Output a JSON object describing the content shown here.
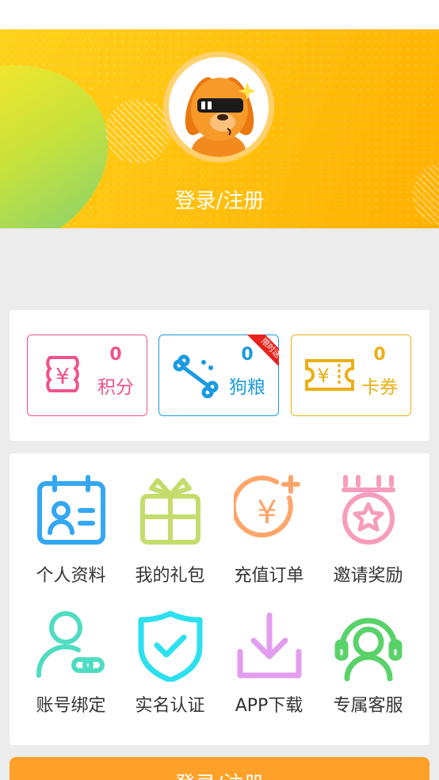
{
  "header": {
    "login_label": "登录/注册"
  },
  "wallet": {
    "points": {
      "value": "0",
      "label": "积分",
      "color": "#f0528c",
      "icon": "coin-stack-icon"
    },
    "dogfood": {
      "value": "0",
      "label": "狗粮",
      "color": "#1a9ae0",
      "icon": "bone-icon",
      "badge": "限时送",
      "badge_color": "#e8221a"
    },
    "coupons": {
      "value": "0",
      "label": "卡券",
      "color": "#ecae14",
      "icon": "ticket-icon"
    }
  },
  "menu": {
    "profile": {
      "label": "个人资料",
      "icon": "profile-card-icon",
      "color": "#35a7f2"
    },
    "gifts": {
      "label": "我的礼包",
      "icon": "gift-icon",
      "color": "#c4dc6c"
    },
    "recharge": {
      "label": "充值订单",
      "icon": "yen-add-icon",
      "color": "#ffa56a"
    },
    "invite": {
      "label": "邀请奖励",
      "icon": "medal-icon",
      "color": "#f79cbc"
    },
    "binding": {
      "label": "账号绑定",
      "icon": "user-link-icon",
      "color": "#4edcc2"
    },
    "verify": {
      "label": "实名认证",
      "icon": "shield-check-icon",
      "color": "#2ce0f0"
    },
    "download": {
      "label": "APP下载",
      "icon": "download-icon",
      "color": "#e39df0"
    },
    "service": {
      "label": "专属客服",
      "icon": "headset-icon",
      "color": "#5ad26a"
    }
  },
  "bottom_button": {
    "label": "登录/注册",
    "color": "#ffa128"
  },
  "colors": {
    "hero": "#ffc20e",
    "background": "#ececec"
  }
}
